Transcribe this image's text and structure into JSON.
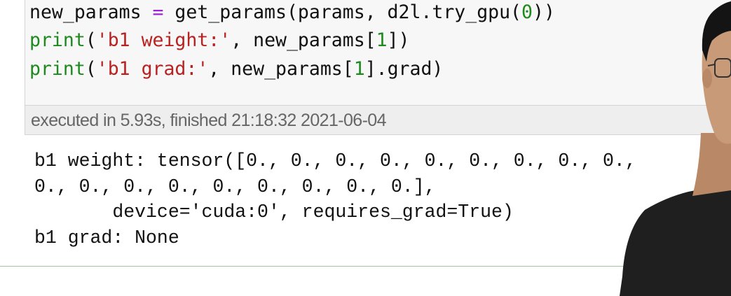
{
  "code_cell": {
    "lines": [
      [
        {
          "t": "new_params ",
          "c": "plain"
        },
        {
          "t": "=",
          "c": "op"
        },
        {
          "t": " get_params(params, d2l.try_gpu(",
          "c": "plain"
        },
        {
          "t": "0",
          "c": "num"
        },
        {
          "t": "))",
          "c": "plain"
        }
      ],
      [
        {
          "t": "print",
          "c": "kw"
        },
        {
          "t": "(",
          "c": "plain"
        },
        {
          "t": "'b1 weight:'",
          "c": "str"
        },
        {
          "t": ", new_params[",
          "c": "plain"
        },
        {
          "t": "1",
          "c": "num"
        },
        {
          "t": "])",
          "c": "plain"
        }
      ],
      [
        {
          "t": "print",
          "c": "kw"
        },
        {
          "t": "(",
          "c": "plain"
        },
        {
          "t": "'b1 grad:'",
          "c": "str"
        },
        {
          "t": ", new_params[",
          "c": "plain"
        },
        {
          "t": "1",
          "c": "num"
        },
        {
          "t": "].grad)",
          "c": "plain"
        }
      ]
    ]
  },
  "execution": {
    "status": "executed in 5.93s, finished 21:18:32 2021-06-04"
  },
  "output": {
    "lines": [
      "b1 weight: tensor([0., 0., 0., 0., 0., 0., 0., 0., 0.,",
      "0., 0., 0., 0., 0., 0., 0., 0., 0.],",
      "       device='cuda:0', requires_grad=True)",
      "b1 grad: None"
    ]
  },
  "colors": {
    "keyword": "#1e8a1e",
    "operator": "#a020d8",
    "string": "#ba2121",
    "number": "#1e8a1e",
    "divider": "#9cc89c"
  }
}
